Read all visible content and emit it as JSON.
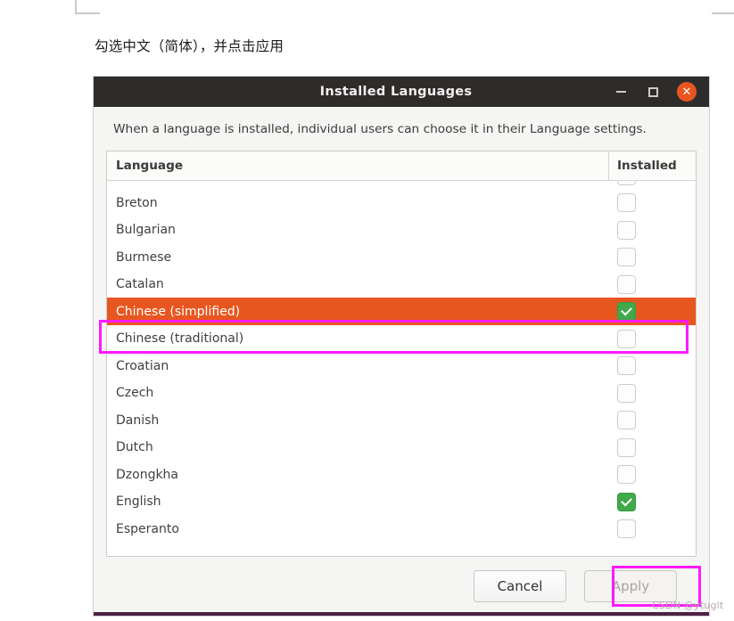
{
  "caption": "勾选中文（简体），并点击应用",
  "window": {
    "title": "Installed Languages",
    "controls": {
      "minimize": "–",
      "maximize": "□",
      "close": "✕"
    },
    "intro": "When a language is installed, individual users can choose it in their Language settings.",
    "table": {
      "headers": {
        "language": "Language",
        "installed": "Installed"
      },
      "rows": [
        {
          "language": "",
          "installed": false,
          "selected": false
        },
        {
          "language": "Breton",
          "installed": false,
          "selected": false
        },
        {
          "language": "Bulgarian",
          "installed": false,
          "selected": false
        },
        {
          "language": "Burmese",
          "installed": false,
          "selected": false
        },
        {
          "language": "Catalan",
          "installed": false,
          "selected": false
        },
        {
          "language": "Chinese (simplified)",
          "installed": true,
          "selected": true
        },
        {
          "language": "Chinese (traditional)",
          "installed": false,
          "selected": false
        },
        {
          "language": "Croatian",
          "installed": false,
          "selected": false
        },
        {
          "language": "Czech",
          "installed": false,
          "selected": false
        },
        {
          "language": "Danish",
          "installed": false,
          "selected": false
        },
        {
          "language": "Dutch",
          "installed": false,
          "selected": false
        },
        {
          "language": "Dzongkha",
          "installed": false,
          "selected": false
        },
        {
          "language": "English",
          "installed": true,
          "selected": false
        },
        {
          "language": "Esperanto",
          "installed": false,
          "selected": false
        }
      ]
    },
    "footer": {
      "cancel_label": "Cancel",
      "apply_label": "Apply",
      "apply_disabled": true
    }
  },
  "watermark": "CSDN @ytuglt",
  "colors": {
    "titlebar": "#2e2c2b",
    "selection_orange": "#e8561f",
    "checkbox_green": "#41a949",
    "annotation_magenta": "#ff19ff",
    "close_button": "#e8561f",
    "bottom_strip": "#4b2246"
  }
}
